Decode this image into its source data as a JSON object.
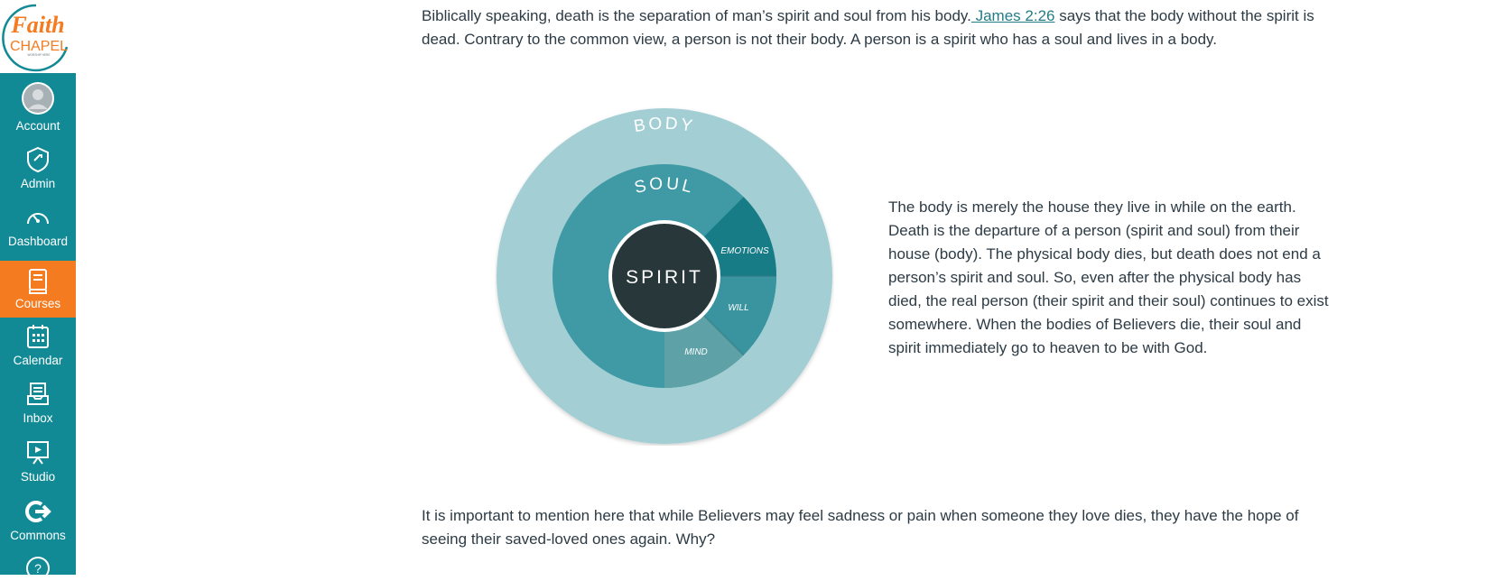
{
  "logo": {
    "line1": "Faith",
    "line2": "CHAPEL",
    "tagline": "WORSHIP HERE"
  },
  "nav": {
    "items": [
      {
        "label": "Account",
        "icon": "avatar-icon"
      },
      {
        "label": "Admin",
        "icon": "shield-icon"
      },
      {
        "label": "Dashboard",
        "icon": "speedometer-icon"
      },
      {
        "label": "Courses",
        "icon": "book-icon",
        "active": true
      },
      {
        "label": "Calendar",
        "icon": "calendar-icon"
      },
      {
        "label": "Inbox",
        "icon": "inbox-icon"
      },
      {
        "label": "Studio",
        "icon": "studio-icon"
      },
      {
        "label": "Commons",
        "icon": "commons-icon"
      },
      {
        "label": "Help",
        "icon": "help-icon"
      }
    ]
  },
  "content": {
    "para1_before": "Biblically speaking, death is the separation of man’s spirit and soul from his body.",
    "para1_link": " James 2:26",
    "para1_after": " says that the body without the spirit is dead. Contrary to the common view, a person is not their body. A person is a spirit who has a soul and lives in a body.",
    "para2": "The body is merely the house they live in while on the earth. Death is the departure of a person (spirit and soul) from their house (body). The physical body dies, but death does not end a person’s spirit and soul. So, even after the physical body has died, the real person (their spirit and their soul) continues to exist somewhere. When the bodies of Believers die, their soul and spirit immediately go to heaven to be with God.",
    "para3": "It is important to mention here that while Believers may feel sadness or pain when someone they love dies, they have the hope of seeing their saved-loved ones again. Why?"
  },
  "diagram": {
    "body": "BODY",
    "soul": "SOUL",
    "spirit": "SPIRIT",
    "emotions": "EMOTIONS",
    "will": "WILL",
    "mind": "MIND",
    "colors": {
      "body": "#a3cfd4",
      "soul": "#3f9aa5",
      "emotions": "#187c87",
      "will": "#3a94a0",
      "mind": "#5ea2a8",
      "spirit": "#28373a"
    }
  },
  "colors": {
    "nav": "#128a96",
    "active": "#f47b20",
    "link": "#237d87",
    "text": "#2d3b45"
  }
}
